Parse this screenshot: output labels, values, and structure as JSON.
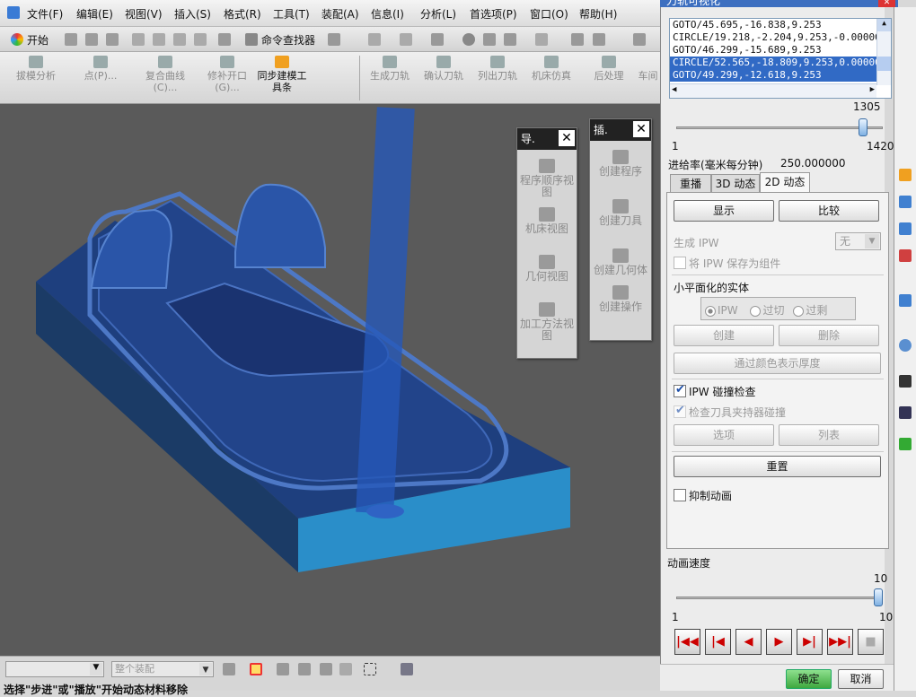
{
  "menubar": {
    "items": [
      "文件(F)",
      "编辑(E)",
      "视图(V)",
      "插入(S)",
      "格式(R)",
      "工具(T)",
      "装配(A)",
      "信息(I)",
      "分析(L)",
      "首选项(P)",
      "窗口(O)",
      "帮助(H)"
    ]
  },
  "toolbar1": {
    "start_label": "开始",
    "command_finder": "命令查找器"
  },
  "toolbar2": {
    "items": [
      "拔模分析",
      "点(P)...",
      "复合曲线(C)...",
      "修补开口(G)...",
      "同步建模工具条",
      "生成刀轨",
      "确认刀轨",
      "列出刀轨",
      "机床仿真",
      "后处理",
      "车间"
    ]
  },
  "nav_panel": {
    "title": "导.",
    "items": [
      "程序顺序视图",
      "机床视图",
      "几何视图",
      "加工方法视图"
    ]
  },
  "insert_panel": {
    "title": "插.",
    "items": [
      "创建程序",
      "创建刀具",
      "创建几何体",
      "创建操作"
    ]
  },
  "status": {
    "filter_placeholder": "",
    "scope_label": "整个装配",
    "prompt": "选择\"步进\"或\"播放\"开始动态材料移除"
  },
  "dialog": {
    "title": "刀轨可视化",
    "gcode": [
      "GOTO/45.695,-16.838,9.253",
      "CIRCLE/19.218,-2.204,9.253,-0.0000000,",
      "GOTO/46.299,-15.689,9.253",
      "CIRCLE/52.565,-18.809,9.253,0.0000000,",
      "GOTO/49.299,-12.618,9.253"
    ],
    "gcode_selected": [
      3,
      4
    ],
    "progress": {
      "value": "1305",
      "min": "1",
      "max": "1420"
    },
    "feedrate_label": "进给率(毫米每分钟)",
    "feedrate_value": "250.000000",
    "tabs": [
      "重播",
      "3D 动态",
      "2D 动态"
    ],
    "active_tab": 2,
    "show_button": "显示",
    "compare_button": "比较",
    "generate_ipw_label": "生成 IPW",
    "generate_ipw_value": "无",
    "save_ipw_label": "将 IPW 保存为组件",
    "facet_group": "小平面化的实体",
    "radio_options": [
      "IPW",
      "过切",
      "过剩"
    ],
    "create_button": "创建",
    "delete_button": "删除",
    "thickness_button": "通过颜色表示厚度",
    "ipw_collision_label": "IPW 碰撞检查",
    "ipw_collision_checked": true,
    "holder_collision_label": "检查刀具夹持器碰撞",
    "holder_collision_checked": true,
    "options_button": "选项",
    "list_button": "列表",
    "reset_button": "重置",
    "suppress_anim_label": "抑制动画",
    "suppress_anim_checked": false,
    "anim_speed_label": "动画速度",
    "speed": {
      "value": "10",
      "min": "1",
      "max": "10"
    },
    "ok_button": "确定",
    "cancel_button": "取消"
  }
}
